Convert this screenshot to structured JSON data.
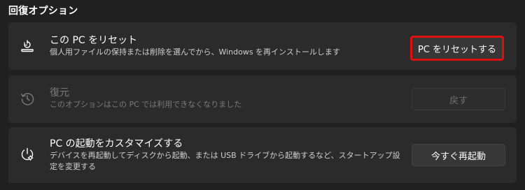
{
  "section": {
    "title": "回復オプション"
  },
  "reset_pc": {
    "title": "この PC をリセット",
    "description": "個人用ファイルの保持または削除を選んでから、Windows を再インストールします",
    "button_label": "PC をリセットする",
    "icon": "reset-pc-icon"
  },
  "restore": {
    "title": "復元",
    "description": "このオプションはこの PC では利用できなくなりました",
    "button_label": "戻す",
    "icon": "history-icon",
    "disabled": true
  },
  "advanced_startup": {
    "title": "PC の起動をカスタマイズする",
    "description": "デバイスを再起動してディスクから起動、または USB ドライブから起動するなど、スタートアップ設定を変更する",
    "button_label": "今すぐ再起動",
    "icon": "power-settings-icon"
  },
  "colors": {
    "background": "#202020",
    "card": "#2b2b2b",
    "highlight_border": "#e01010",
    "disabled_text": "#7a7a7a"
  }
}
